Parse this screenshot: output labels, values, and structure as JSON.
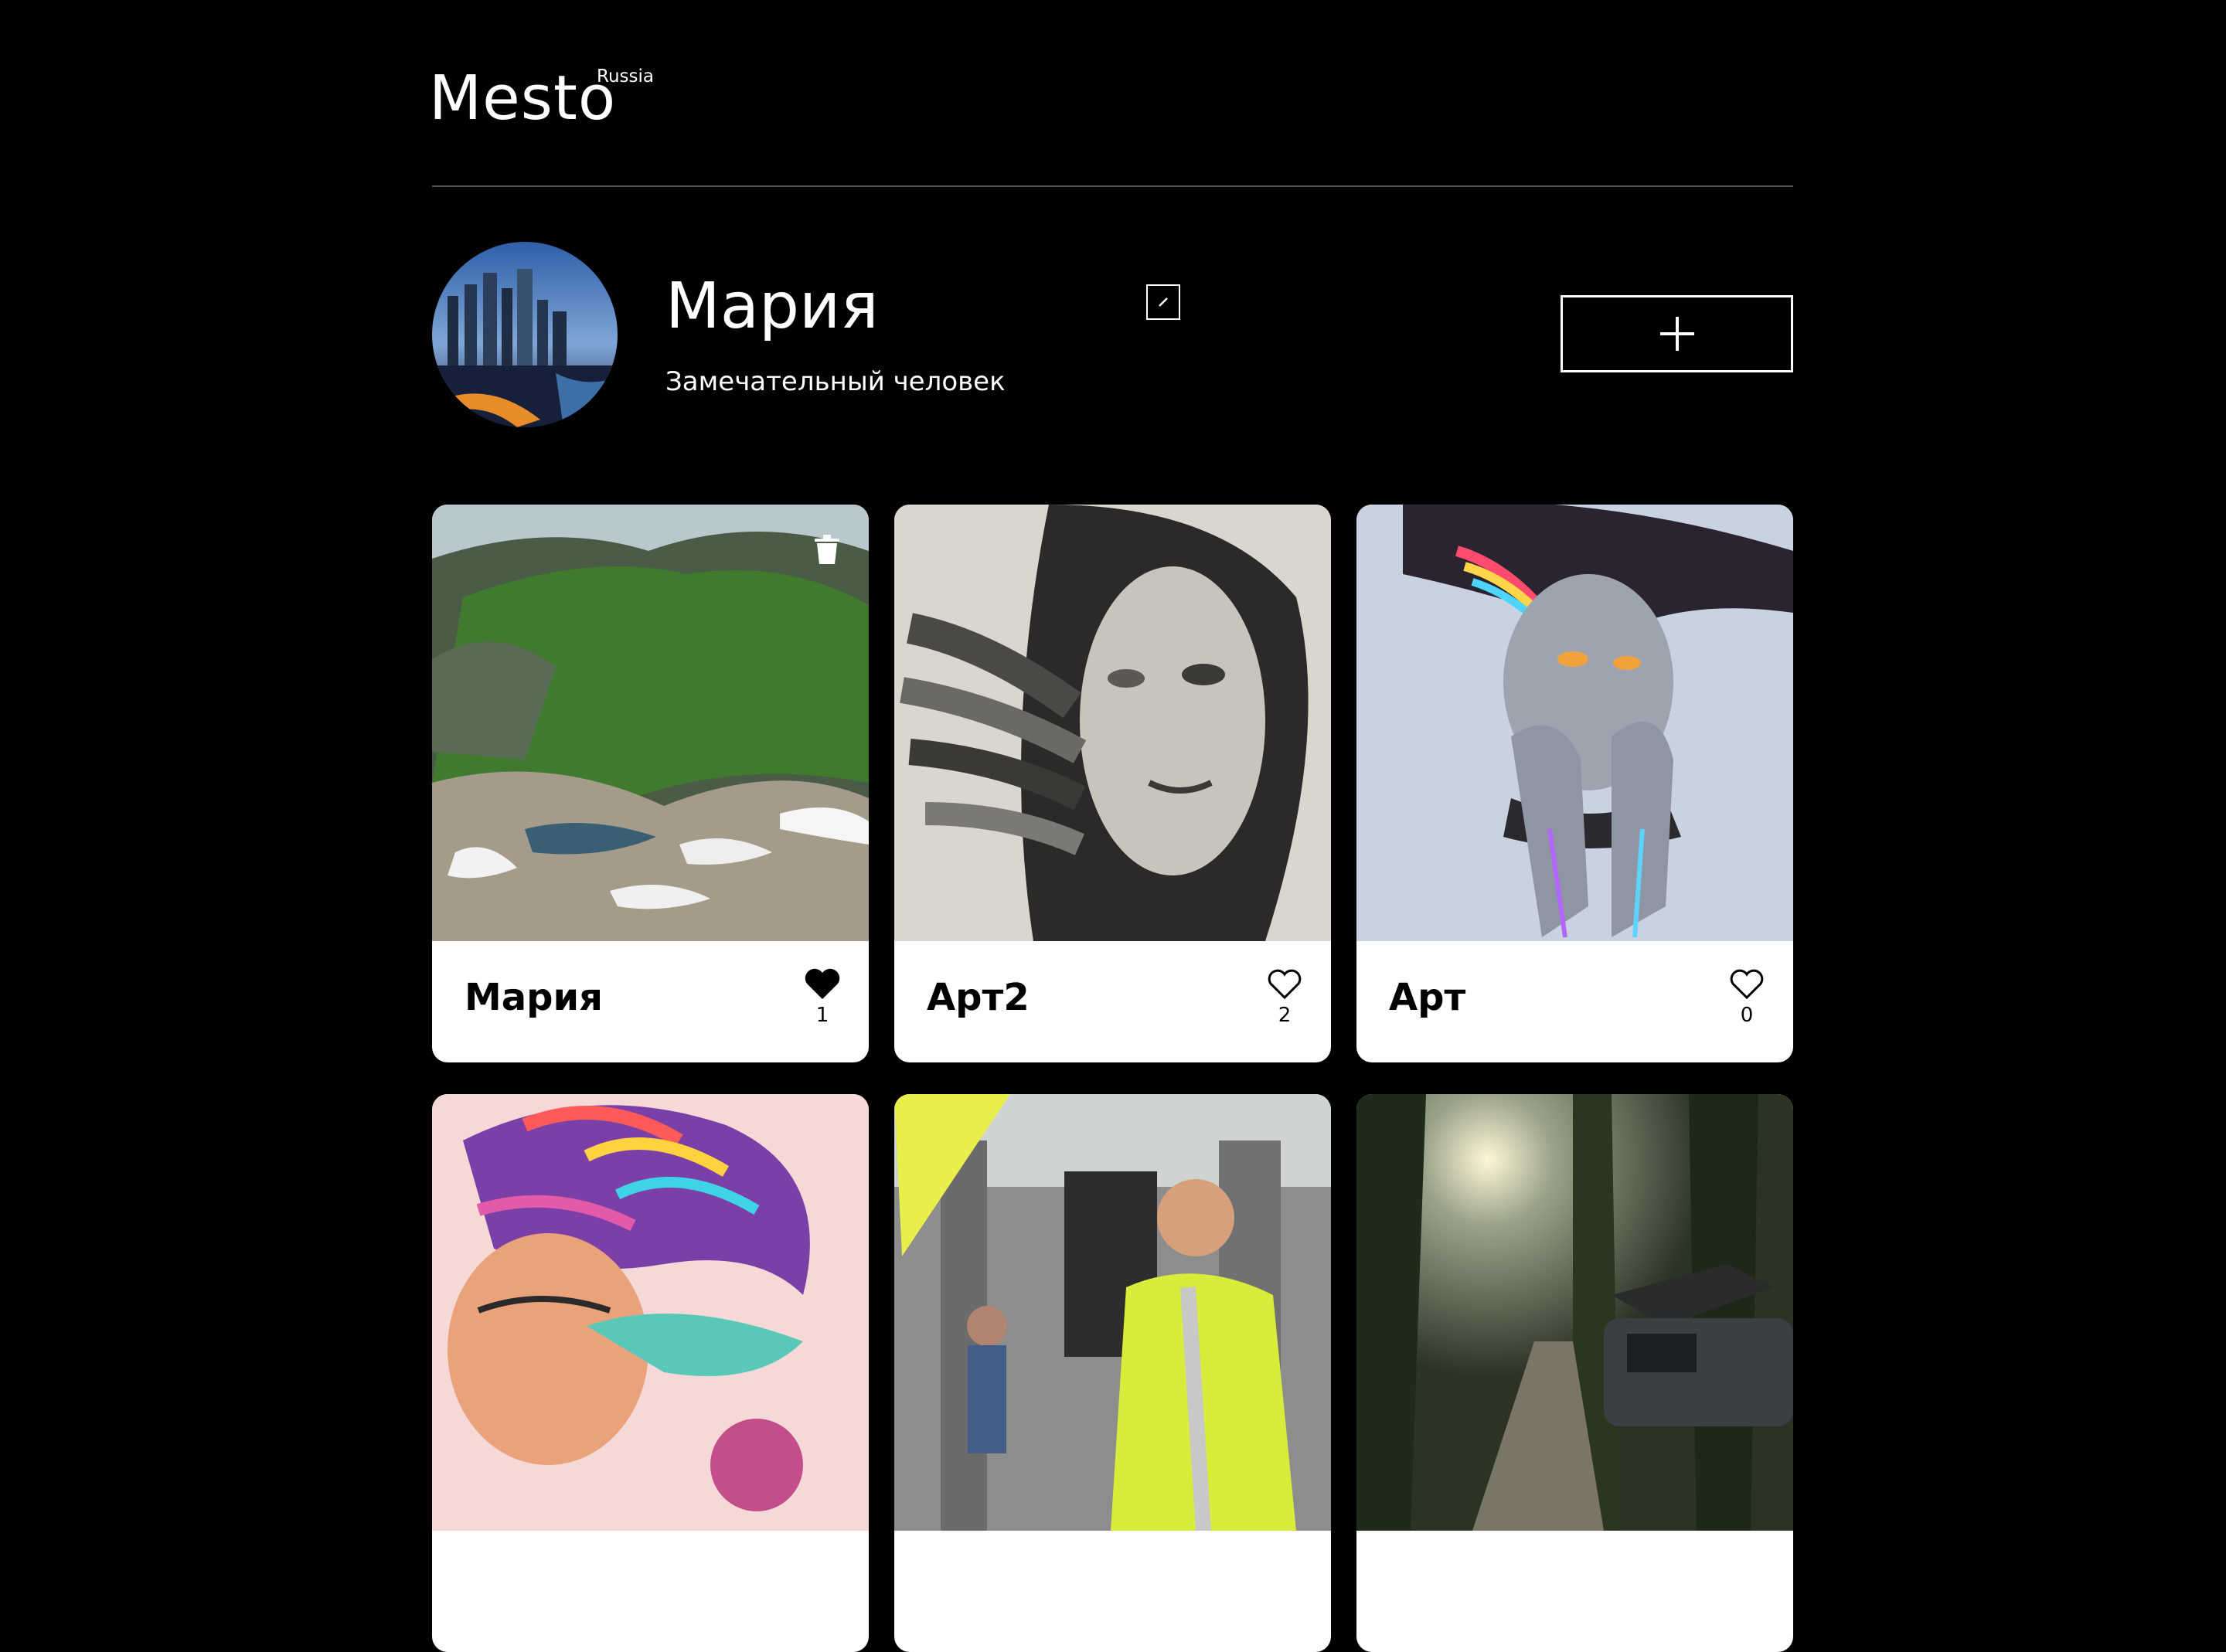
{
  "header": {
    "logo": "Mesto",
    "logo_sup": "Russia"
  },
  "profile": {
    "name": "Мария",
    "about": "Замечательный человек",
    "edit_icon": "pencil-icon",
    "add_icon": "plus-icon"
  },
  "cards": [
    {
      "title": "Мария",
      "likes": "1",
      "liked": true,
      "deletable": true,
      "image": "mountain-valley"
    },
    {
      "title": "Арт2",
      "likes": "2",
      "liked": false,
      "deletable": false,
      "image": "feather-portrait-sketch"
    },
    {
      "title": "Арт",
      "likes": "0",
      "liked": false,
      "deletable": false,
      "image": "neon-girl-illustration"
    },
    {
      "title": "",
      "likes": "",
      "liked": false,
      "deletable": false,
      "image": "psychedelic-portrait"
    },
    {
      "title": "",
      "likes": "",
      "liked": false,
      "deletable": false,
      "image": "warehouse-worker"
    },
    {
      "title": "",
      "likes": "",
      "liked": false,
      "deletable": false,
      "image": "forest-road-car"
    }
  ],
  "colors": {
    "background": "#000000",
    "card_background": "#ffffff",
    "divider": "#545454"
  }
}
